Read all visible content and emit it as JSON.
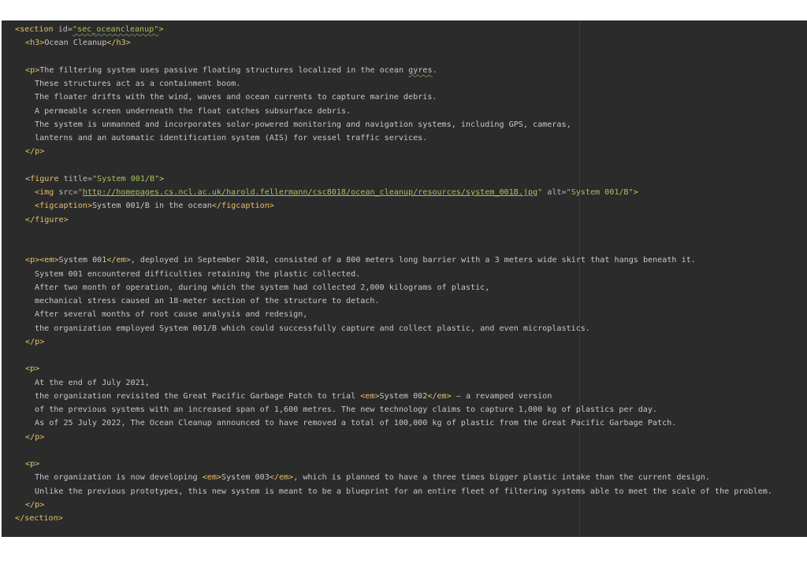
{
  "editor": {
    "lines": [
      {
        "indent": 0,
        "parts": [
          {
            "t": "<section",
            "c": "tag"
          },
          {
            "t": " id=",
            "c": "attr"
          },
          {
            "t": "\"sec_oceancleanup\"",
            "c": "val squiggle"
          },
          {
            "t": ">",
            "c": "tag"
          }
        ]
      },
      {
        "indent": 1,
        "parts": [
          {
            "t": "<h3>",
            "c": "tag"
          },
          {
            "t": "Ocean Cleanup",
            "c": "txt"
          },
          {
            "t": "</h3>",
            "c": "tag"
          }
        ]
      },
      {
        "indent": 1,
        "parts": []
      },
      {
        "indent": 1,
        "parts": [
          {
            "t": "<p>",
            "c": "tag"
          },
          {
            "t": "The filtering system uses passive floating structures localized in the ocean ",
            "c": "txt"
          },
          {
            "t": "gyres",
            "c": "txt squiggle"
          },
          {
            "t": ".",
            "c": "txt"
          }
        ]
      },
      {
        "indent": 2,
        "parts": [
          {
            "t": "These structures act as a containment boom.",
            "c": "txt"
          }
        ]
      },
      {
        "indent": 2,
        "parts": [
          {
            "t": "The floater drifts with the wind, waves and ocean currents to capture marine debris.",
            "c": "txt"
          }
        ]
      },
      {
        "indent": 2,
        "parts": [
          {
            "t": "A permeable screen underneath the float catches subsurface debris.",
            "c": "txt"
          }
        ]
      },
      {
        "indent": 2,
        "parts": [
          {
            "t": "The system is unmanned and incorporates solar-powered monitoring and navigation systems, including GPS, cameras,",
            "c": "txt"
          }
        ]
      },
      {
        "indent": 2,
        "parts": [
          {
            "t": "lanterns and an automatic identification system (AIS) for vessel traffic services.",
            "c": "txt"
          }
        ]
      },
      {
        "indent": 1,
        "parts": [
          {
            "t": "</p>",
            "c": "tag"
          }
        ]
      },
      {
        "indent": 1,
        "parts": []
      },
      {
        "indent": 1,
        "parts": [
          {
            "t": "<figure",
            "c": "tag"
          },
          {
            "t": " title=",
            "c": "attr"
          },
          {
            "t": "\"System 001/B\"",
            "c": "val"
          },
          {
            "t": ">",
            "c": "tag"
          }
        ]
      },
      {
        "indent": 2,
        "parts": [
          {
            "t": "<img",
            "c": "tag"
          },
          {
            "t": " src=",
            "c": "attr"
          },
          {
            "t": "\"",
            "c": "val"
          },
          {
            "t": "http://homepages.cs.ncl.ac.uk/harold.fellermann/csc8018/ocean_cleanup/resources/system_001B.jpg",
            "c": "url"
          },
          {
            "t": "\"",
            "c": "val"
          },
          {
            "t": " alt=",
            "c": "attr"
          },
          {
            "t": "\"System 001/B\"",
            "c": "val"
          },
          {
            "t": ">",
            "c": "tag"
          }
        ]
      },
      {
        "indent": 2,
        "parts": [
          {
            "t": "<figcaption>",
            "c": "tag"
          },
          {
            "t": "System 001/B in the ocean",
            "c": "txt"
          },
          {
            "t": "</figcaption>",
            "c": "tag"
          }
        ]
      },
      {
        "indent": 1,
        "parts": [
          {
            "t": "</figure>",
            "c": "tag"
          }
        ]
      },
      {
        "indent": 1,
        "parts": []
      },
      {
        "indent": 1,
        "parts": []
      },
      {
        "indent": 1,
        "parts": [
          {
            "t": "<p><em>",
            "c": "tag"
          },
          {
            "t": "System 001",
            "c": "txt"
          },
          {
            "t": "</em>",
            "c": "tag"
          },
          {
            "t": ", deployed in September 2018, consisted of a 800 meters long barrier with a 3 meters wide skirt that hangs beneath it.",
            "c": "txt"
          }
        ]
      },
      {
        "indent": 2,
        "parts": [
          {
            "t": "System 001 encountered difficulties retaining the plastic collected.",
            "c": "txt"
          }
        ]
      },
      {
        "indent": 2,
        "parts": [
          {
            "t": "After two month of operation, during which the system had collected 2,000 kilograms of plastic,",
            "c": "txt"
          }
        ]
      },
      {
        "indent": 2,
        "parts": [
          {
            "t": "mechanical stress caused an 18-meter section of the structure to detach.",
            "c": "txt"
          }
        ]
      },
      {
        "indent": 2,
        "parts": [
          {
            "t": "After several months of root cause analysis and redesign,",
            "c": "txt"
          }
        ]
      },
      {
        "indent": 2,
        "parts": [
          {
            "t": "the organization employed System 001/B which could successfully capture and collect plastic, and even microplastics.",
            "c": "txt"
          }
        ]
      },
      {
        "indent": 1,
        "parts": [
          {
            "t": "</p>",
            "c": "tag"
          }
        ]
      },
      {
        "indent": 1,
        "parts": []
      },
      {
        "indent": 1,
        "parts": [
          {
            "t": "<p>",
            "c": "tag"
          }
        ]
      },
      {
        "indent": 2,
        "parts": [
          {
            "t": "At the end of July 2021,",
            "c": "txt"
          }
        ]
      },
      {
        "indent": 2,
        "parts": [
          {
            "t": "the organization revisited the Great Pacific Garbage Patch to trial ",
            "c": "txt"
          },
          {
            "t": "<em>",
            "c": "tag"
          },
          {
            "t": "System 002",
            "c": "txt"
          },
          {
            "t": "</em>",
            "c": "tag"
          },
          {
            "t": " – a revamped version",
            "c": "txt"
          }
        ]
      },
      {
        "indent": 2,
        "parts": [
          {
            "t": "of the previous systems with an increased span of 1,600 metres. The new technology claims to capture 1,000 kg of plastics per day.",
            "c": "txt"
          }
        ]
      },
      {
        "indent": 2,
        "parts": [
          {
            "t": "As of 25 July 2022, The Ocean Cleanup announced to have removed a total of 100,000 kg of plastic from the Great Pacific Garbage Patch.",
            "c": "txt"
          }
        ]
      },
      {
        "indent": 1,
        "parts": [
          {
            "t": "</p>",
            "c": "tag"
          }
        ]
      },
      {
        "indent": 1,
        "parts": []
      },
      {
        "indent": 1,
        "parts": [
          {
            "t": "<p>",
            "c": "tag"
          }
        ]
      },
      {
        "indent": 2,
        "parts": [
          {
            "t": "The organization is now developing ",
            "c": "txt"
          },
          {
            "t": "<em>",
            "c": "tag"
          },
          {
            "t": "System 003",
            "c": "txt"
          },
          {
            "t": "</em>",
            "c": "tag"
          },
          {
            "t": ", which is planned to have a three times bigger plastic intake than the current design.",
            "c": "txt"
          }
        ]
      },
      {
        "indent": 2,
        "parts": [
          {
            "t": "Unlike the previous prototypes, this new system is meant to be a blueprint for an entire fleet of filtering systems able to meet the scale of the problem.",
            "c": "txt"
          }
        ]
      },
      {
        "indent": 1,
        "parts": [
          {
            "t": "</p>",
            "c": "tag"
          }
        ]
      },
      {
        "indent": 0,
        "parts": [
          {
            "t": "</section>",
            "c": "tag"
          }
        ]
      }
    ]
  }
}
